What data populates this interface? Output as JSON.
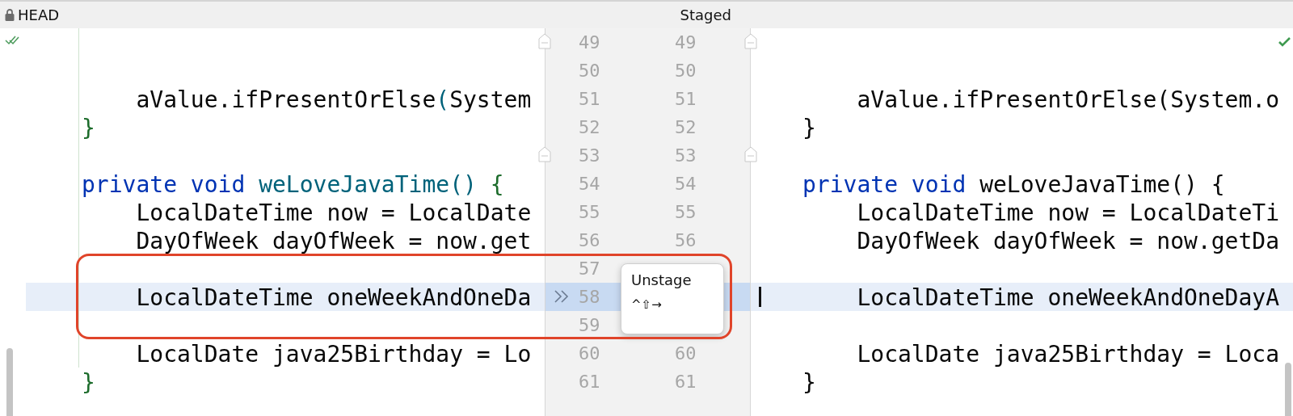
{
  "header": {
    "left_title": "HEAD",
    "right_title": "Staged"
  },
  "popup": {
    "title": "Unstage",
    "shortcut": "^⇧→"
  },
  "rows": [
    {
      "left_number": "49",
      "right_number": "49",
      "selected": false,
      "fold_marker": true,
      "left": [],
      "right": []
    },
    {
      "left_number": "50",
      "right_number": "50",
      "selected": false,
      "fold_marker": false,
      "left": [],
      "right": []
    },
    {
      "left_number": "51",
      "right_number": "51",
      "selected": false,
      "fold_marker": false,
      "left": [
        {
          "text": "    aValue.ifPresentOrElse",
          "kind": "plain"
        },
        {
          "text": "(",
          "kind": "method"
        },
        {
          "text": "System",
          "kind": "plain"
        }
      ],
      "right": [
        {
          "text": "    aValue.ifPresentOrElse(System.o",
          "kind": "plain"
        }
      ]
    },
    {
      "left_number": "52",
      "right_number": "52",
      "selected": false,
      "fold_marker": false,
      "left": [
        {
          "text": "}",
          "kind": "brace"
        }
      ],
      "right": [
        {
          "text": "}",
          "kind": "plain"
        }
      ]
    },
    {
      "left_number": "53",
      "right_number": "53",
      "selected": false,
      "fold_marker": true,
      "left": [],
      "right": []
    },
    {
      "left_number": "54",
      "right_number": "54",
      "selected": false,
      "fold_marker": false,
      "left": [
        {
          "text": "private void ",
          "kind": "keyword"
        },
        {
          "text": "weLoveJavaTime() ",
          "kind": "method"
        },
        {
          "text": "{",
          "kind": "brace"
        }
      ],
      "right": [
        {
          "text": "private void ",
          "kind": "keyword"
        },
        {
          "text": "weLoveJavaTime() {",
          "kind": "plain"
        }
      ]
    },
    {
      "left_number": "55",
      "right_number": "55",
      "selected": false,
      "fold_marker": false,
      "left": [
        {
          "text": "    LocalDateTime now = LocalDate",
          "kind": "plain"
        }
      ],
      "right": [
        {
          "text": "    LocalDateTime now = LocalDateTi",
          "kind": "plain"
        }
      ]
    },
    {
      "left_number": "56",
      "right_number": "56",
      "selected": false,
      "fold_marker": false,
      "left": [
        {
          "text": "    DayOfWeek dayOfWeek = now.get",
          "kind": "plain"
        }
      ],
      "right": [
        {
          "text": "    DayOfWeek dayOfWeek = now.getDa",
          "kind": "plain"
        }
      ]
    },
    {
      "left_number": "57",
      "selected": false,
      "fold_marker": false,
      "left": [],
      "right": []
    },
    {
      "left_number": "58",
      "selected": true,
      "fold_marker": false,
      "left": [
        {
          "text": "    LocalDateTime oneWeekAndOneDa",
          "kind": "plain"
        }
      ],
      "right": [
        {
          "text": "    LocalDateTime oneWeekAndOneDayA",
          "kind": "plain"
        }
      ]
    },
    {
      "left_number": "59",
      "selected": false,
      "fold_marker": false,
      "left": [],
      "right": []
    },
    {
      "left_number": "60",
      "right_number": "60",
      "selected": false,
      "fold_marker": false,
      "left": [
        {
          "text": "    LocalDate java25Birthday = Lo",
          "kind": "plain"
        }
      ],
      "right": [
        {
          "text": "    LocalDate java25Birthday = Loca",
          "kind": "plain"
        }
      ]
    },
    {
      "left_number": "61",
      "right_number": "61",
      "selected": false,
      "fold_marker": false,
      "left": [
        {
          "text": "}",
          "kind": "brace"
        }
      ],
      "right": [
        {
          "text": "}",
          "kind": "plain"
        }
      ]
    }
  ]
}
